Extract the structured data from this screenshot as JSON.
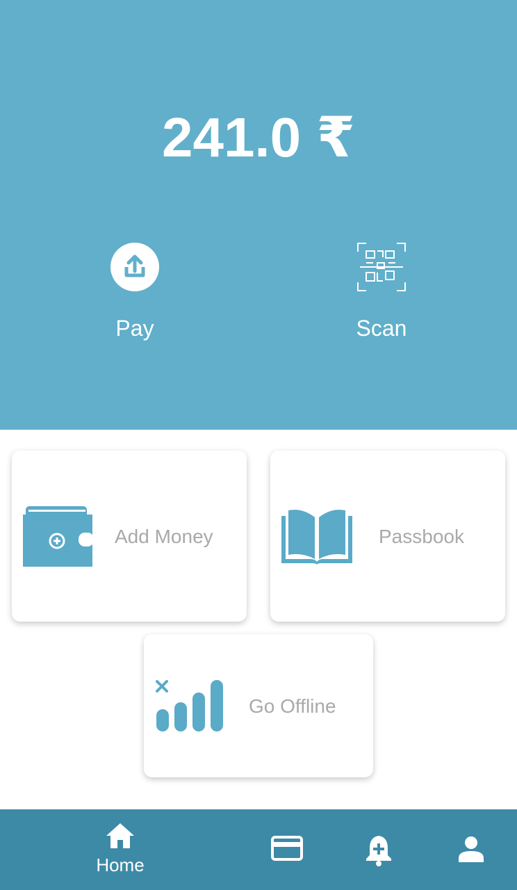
{
  "balance": {
    "amount": "241.0 ₹"
  },
  "actions": [
    {
      "label": "Pay",
      "icon": "upload-icon"
    },
    {
      "label": "Scan",
      "icon": "qr-scan-icon"
    }
  ],
  "cards": {
    "add_money": {
      "label": "Add Money",
      "icon": "wallet-add-icon"
    },
    "passbook": {
      "label": "Passbook",
      "icon": "open-book-icon"
    },
    "go_offline": {
      "label": "Go Offline",
      "icon": "no-signal-icon"
    }
  },
  "bottom_nav": {
    "home": {
      "label": "Home",
      "icon": "home-icon"
    },
    "items": [
      {
        "icon": "credit-card-icon"
      },
      {
        "icon": "notification-add-icon"
      },
      {
        "icon": "person-icon"
      }
    ]
  },
  "colors": {
    "primary": "#61afca",
    "nav_bar": "#3d8aa6",
    "icon_accent": "#5aaac8",
    "card_text": "#a9a9a9"
  }
}
